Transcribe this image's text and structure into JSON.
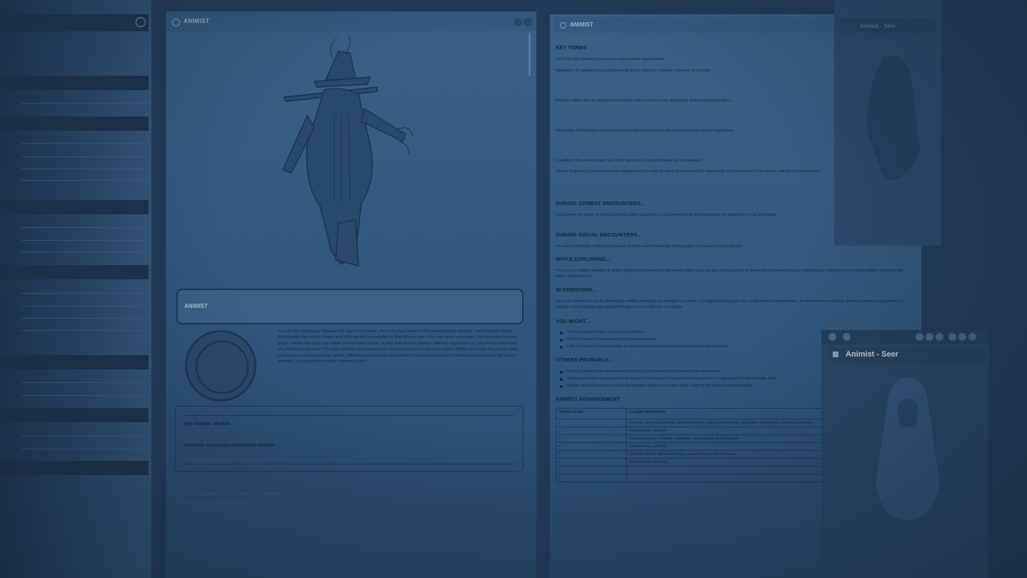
{
  "sidebar": {
    "bars": [
      "",
      "",
      "",
      "",
      "",
      "",
      "",
      ""
    ]
  },
  "center": {
    "title": "ANIMIST",
    "card_name": "ANIMIST",
    "flavor": "You are the interlocutor between the seen and unseen, the voice that connects the mortal and the spiritual. You bond with spirits, manifesting their distinct magic and allowing their knowledge to flow through you. You may focus apparitions that grant you healing magic, others that grant you spells of destructive power, or pick and choose between different apparitions as your environment and circumstances demand. You may consider your powers part of a sacred trust or see your unique abilities as a sign that you've been chosen as a champion of two worlds. Whether you advocate for mortals in the planes beyond or whether you represent the spirits' interests, you provide the bridge between realms.",
    "key_attribute": "Key Attribute: Wisdom",
    "key_attribute_text": "At 1st level, your class gives you an attribute boost to Wisdom.",
    "hit_points": "Hit Points: 8 plus your Constitution modifier",
    "hit_points_text": "You increase your maximum number of HP by this number at 1st level and every level thereafter."
  },
  "right": {
    "title": "ANIMIST",
    "key_terms": "KEY TERMS",
    "key_terms_intro": "You'll see the following key terms in many animist class features.",
    "apparition": "Apparition: An apparition is a spiritual entity that is linked to a location, creature, or concept.",
    "apparition_p2": "Animists obtain with the apparition feat and/or one or more of your apparitions during daily preparations.",
    "wandering": "Wandering: Wandering is a new trait that identifies animist feats attuned to particular types of apparitions.",
    "stance_intro": "In addition, the animist makes use of the stance trait, reprinted below for convenience.",
    "stance": "Stance: A stance is a general combat strategy that you enter by using an action with the stance trait, and you remain in the stance until you get knocked out.",
    "combat_h": "DURING COMBAT ENCOUNTERS...",
    "combat": "You channel the power of spiritual entities called apparitions to cast potent spells and manipulate the battlefield to your advantage.",
    "social_h": "DURING SOCIAL ENCOUNTERS...",
    "social": "You watch and listen, letting the whispers of spirits and otherworldly beings guide you toward sound judgment.",
    "explore_h": "WHILE EXPLORING...",
    "explore": "You use your patient attention to detail, alongside clues and special senses gifted to you by your spiritual allies, to detect threats before they can ambush your companions or to notice hidden treasures that others might pass by.",
    "downtime_h": "IN DOWNTIME...",
    "downtime": "You seek out areas close to otherworldly entities who bring you strength or comfort. You might tend to grave sites, tread primeval wildernesses, or ride the rivers and seas. Animists attuned to apparitions of wisdom and knowledge may spend their quiet hours in libraries or temples.",
    "might_h": "YOU MIGHT...",
    "might": [
      "Talk to spiritual entities only you can perceive.",
      "Prefer to speak in stories and descriptive anecdotes.",
      "Look at the world from a broader or more metaphorical perspective than most mortal creatures."
    ],
    "others_h": "OTHERS PROBABLY...",
    "others": [
      "Find you detached or absent-minded due to your focus on things beyond their awareness.",
      "Value your wisdom as someone with access to vast troves of experience beyond what a single person could normally attain.",
      "Mistake you for being cruel or lacking empathy because you give equal weight to the material and immaterial."
    ],
    "adv_h": "ANIMIST ADVANCEMENT",
    "table_head": [
      "YOUR LEVEL",
      "CLASS FEATURES"
    ],
    "table_rows": [
      [
        "1",
        "Ancestry and background, attribute boosts, initial proficiencies, apparition attunement, animistic practice"
      ],
      [
        "2",
        "Animist feat, skill feat"
      ],
      [
        "3",
        "2nd-rank spells, fortitude expertise, general feat, skill increase"
      ],
      [
        "4",
        "Animist feat, skill feat"
      ],
      [
        "5",
        "3rd-rank spells, attribute boosts, ancestry feat, skill increase"
      ],
      [
        "6",
        "Animist feat, skill feat"
      ],
      [
        "7",
        ""
      ],
      [
        "8",
        ""
      ]
    ]
  },
  "art_window": {
    "title": "Animist - Seer"
  },
  "seer": {
    "title": "Animist - Seer"
  }
}
